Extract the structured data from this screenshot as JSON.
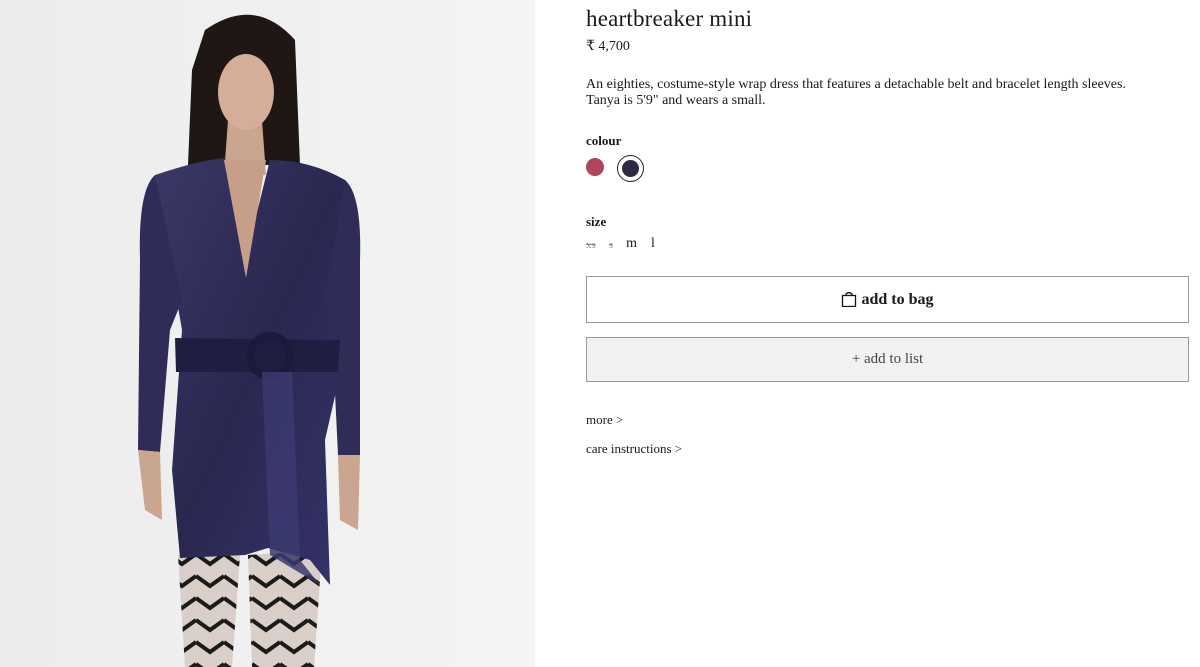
{
  "product": {
    "title": "heartbreaker mini",
    "price": "₹ 4,700",
    "description_line1": "An eighties, costume-style wrap dress that features a detachable belt and bracelet length sleeves.",
    "description_line2": "Tanya is 5'9\" and wears a small."
  },
  "colour": {
    "label": "colour",
    "options": [
      {
        "color": "#b0455b",
        "selected": false
      },
      {
        "color": "#2e2b40",
        "selected": true
      }
    ]
  },
  "size": {
    "label": "size",
    "options": [
      {
        "label": "xs",
        "available": false
      },
      {
        "label": "s",
        "available": false
      },
      {
        "label": "m",
        "available": true
      },
      {
        "label": "l",
        "available": true
      }
    ]
  },
  "actions": {
    "add_to_bag": "add to bag",
    "add_to_list": "+ add to list"
  },
  "links": {
    "more": "more >",
    "care": "care instructions >"
  },
  "icons": {
    "bag": "shopping-bag-icon"
  },
  "image": {
    "subject": "model wearing navy satin wrap mini dress with belt and patterned tights"
  }
}
